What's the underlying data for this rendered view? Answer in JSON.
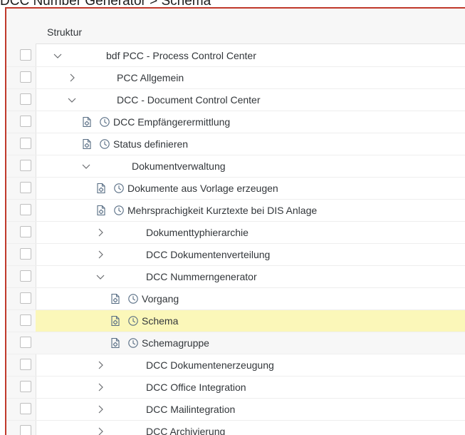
{
  "title": "DCC Number Generator > Schema",
  "table": {
    "header": "Struktur",
    "rows": [
      {
        "label": "bdf PCC - Process Control Center",
        "type": "folder",
        "expanded": true
      },
      {
        "label": "PCC Allgemein",
        "type": "folder",
        "expanded": false
      },
      {
        "label": "DCC - Document Control Center",
        "type": "folder",
        "expanded": true
      },
      {
        "label": "DCC Empfängerermittlung",
        "type": "activity"
      },
      {
        "label": "Status definieren",
        "type": "activity"
      },
      {
        "label": "Dokumentverwaltung",
        "type": "folder",
        "expanded": true
      },
      {
        "label": "Dokumente aus Vorlage erzeugen",
        "type": "activity"
      },
      {
        "label": "Mehrsprachigkeit Kurztexte bei DIS Anlage",
        "type": "activity"
      },
      {
        "label": "Dokumenttyphierarchie",
        "type": "folder",
        "expanded": false
      },
      {
        "label": "DCC Dokumentenverteilung",
        "type": "folder",
        "expanded": false
      },
      {
        "label": "DCC Nummerngenerator",
        "type": "folder",
        "expanded": true
      },
      {
        "label": "Vorgang",
        "type": "activity"
      },
      {
        "label": "Schema",
        "type": "activity",
        "highlighted": true
      },
      {
        "label": "Schemagruppe",
        "type": "activity"
      },
      {
        "label": "DCC Dokumentenerzeugung",
        "type": "folder",
        "expanded": false
      },
      {
        "label": "DCC Office Integration",
        "type": "folder",
        "expanded": false
      },
      {
        "label": "DCC Mailintegration",
        "type": "folder",
        "expanded": false
      },
      {
        "label": "DCC Archivierung",
        "type": "folder",
        "expanded": false
      }
    ]
  },
  "colors": {
    "frame_border": "#c0392b",
    "highlight": "#fbf7b9",
    "header_bg": "#f7f7f7"
  },
  "icons": {
    "expanded": "chevron-down-icon",
    "collapsed": "chevron-right-icon",
    "activity_doc": "document-settings-icon",
    "activity_clock": "clock-icon"
  }
}
